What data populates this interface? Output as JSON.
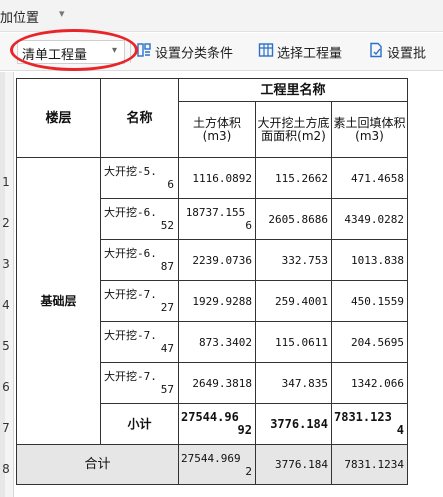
{
  "topbar": {
    "label": "加位置",
    "caret": "▾"
  },
  "toolbar": {
    "combo_value": "清单工程量",
    "combo_caret": "▾",
    "buttons": [
      {
        "label": "设置分类条件",
        "icon": "category-settings-icon"
      },
      {
        "label": "选择工程量",
        "icon": "select-quantity-icon"
      },
      {
        "label": "设置批",
        "icon": "batch-settings-icon"
      }
    ]
  },
  "table": {
    "group_header": "工程里名称",
    "headers": {
      "floor": "楼层",
      "name": "名称",
      "col1": "土方体积(m3)",
      "col2": "大开挖土方底面面积(m2)",
      "col3": "素土回填体积(m3)"
    },
    "floor_value": "基础层",
    "rows": [
      {
        "row": "1",
        "name_a": "大开挖-5.",
        "name_b": "6",
        "v1": "1116.0892",
        "v2": "115.2662",
        "v3": "471.4658"
      },
      {
        "row": "2",
        "name_a": "大开挖-6.",
        "name_b": "52",
        "v1a": "18737.155",
        "v1b": "6",
        "v2": "2605.8686",
        "v3": "4349.0282"
      },
      {
        "row": "3",
        "name_a": "大开挖-6.",
        "name_b": "87",
        "v1": "2239.0736",
        "v2": "332.753",
        "v3": "1013.838"
      },
      {
        "row": "4",
        "name_a": "大开挖-7.",
        "name_b": "27",
        "v1": "1929.9288",
        "v2": "259.4001",
        "v3": "450.1559"
      },
      {
        "row": "5",
        "name_a": "大开挖-7.",
        "name_b": "47",
        "v1": "873.3402",
        "v2": "115.0611",
        "v3": "204.5695"
      },
      {
        "row": "6",
        "name_a": "大开挖-7.",
        "name_b": "57",
        "v1": "2649.3818",
        "v2": "347.835",
        "v3": "1342.066"
      }
    ],
    "subtotal": {
      "row": "7",
      "label": "小计",
      "v1a": "27544.96",
      "v1b": "92",
      "v2": "3776.184",
      "v3a": "7831.123",
      "v3b": "4"
    },
    "total": {
      "row": "8",
      "label": "合计",
      "v1a": "27544.969",
      "v1b": "2",
      "v2": "3776.184",
      "v3": "7831.1234"
    }
  }
}
